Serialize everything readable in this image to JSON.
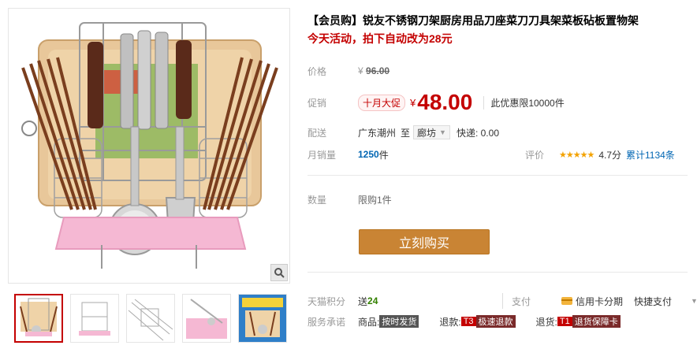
{
  "product": {
    "title": "【会员购】锐友不锈钢刀架厨房用品刀座菜刀刀具架菜板砧板置物架",
    "promo_line": "今天活动，拍下自动改为28元"
  },
  "price": {
    "label": "价格",
    "currency": "¥",
    "original": "96.00"
  },
  "promo": {
    "label": "促销",
    "tag": "十月大促",
    "currency": "¥",
    "price": "48.00",
    "limit_note": "此优惠限10000件"
  },
  "shipping": {
    "label": "配送",
    "origin": "广东潮州",
    "to": "至",
    "destination": "廊坊",
    "fee": "快递: 0.00"
  },
  "sales": {
    "label": "月销量",
    "count": "1250",
    "unit": "件",
    "rating_label": "评价",
    "stars": "★★★★★",
    "score": "4.7分",
    "total": "累计1134条"
  },
  "quantity": {
    "label": "数量",
    "limit": "限购1件"
  },
  "buy_button": "立刻购买",
  "points": {
    "label": "天猫积分",
    "prefix": "送",
    "value": "24"
  },
  "payment": {
    "label": "支付",
    "credit": "信用卡分期",
    "quick": "快捷支付"
  },
  "service": {
    "label": "服务承诺",
    "goods_label": "商品:",
    "goods_badge": "按时发货",
    "refund_label": "退款:",
    "refund_t": "T3",
    "refund_badge": "极速退款",
    "return_label": "退货:",
    "return_t": "T1",
    "return_badge": "退货保障卡"
  }
}
